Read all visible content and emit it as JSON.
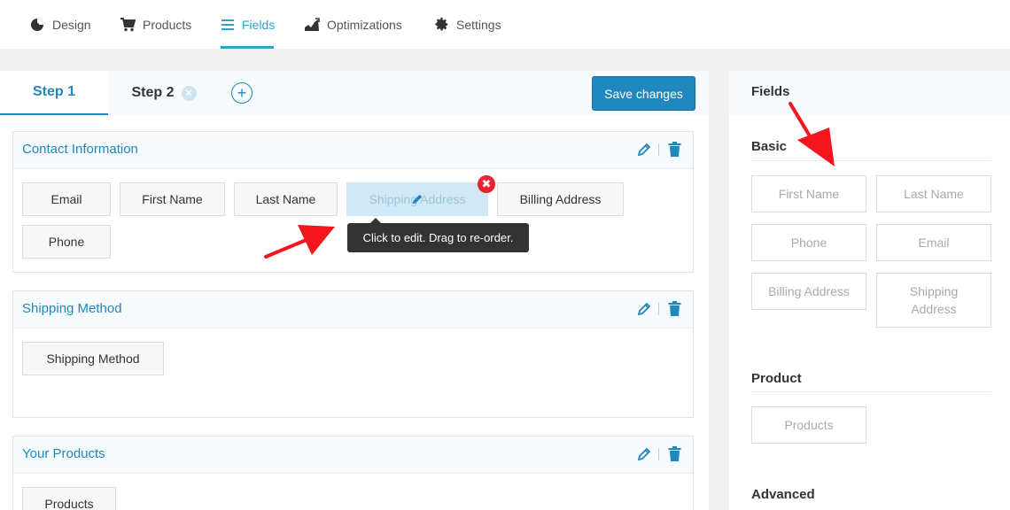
{
  "nav": {
    "items": [
      {
        "label": "Design",
        "icon": "design-icon"
      },
      {
        "label": "Products",
        "icon": "cart-icon"
      },
      {
        "label": "Fields",
        "icon": "list-icon"
      },
      {
        "label": "Optimizations",
        "icon": "chart-icon"
      },
      {
        "label": "Settings",
        "icon": "gear-icon"
      }
    ],
    "active": "Fields"
  },
  "steps": {
    "tabs": [
      {
        "label": "Step 1",
        "active": true
      },
      {
        "label": "Step 2",
        "active": false
      }
    ],
    "remove_glyph": "✕",
    "add_glyph": "+",
    "save_label": "Save changes"
  },
  "sections": [
    {
      "title": "Contact Information",
      "fields": [
        "Email",
        "First Name",
        "Last Name",
        "Shipping Address",
        "Billing Address",
        "Phone"
      ]
    },
    {
      "title": "Shipping Method",
      "fields": [
        "Shipping Method"
      ]
    },
    {
      "title": "Your Products",
      "fields": [
        "Products"
      ]
    }
  ],
  "tooltip": "Click to edit. Drag to re-order.",
  "remove_glyph": "✖",
  "palette": {
    "title": "Fields",
    "groups": [
      {
        "title": "Basic",
        "fields": [
          "First Name",
          "Last Name",
          "Phone",
          "Email",
          "Billing Address",
          "Shipping Address"
        ]
      },
      {
        "title": "Product",
        "fields": [
          "Products"
        ]
      },
      {
        "title": "Advanced",
        "fields": []
      }
    ]
  },
  "colors": {
    "accent": "#1f88be",
    "nav_active": "#2ea2cc",
    "remove": "#e8222f",
    "arrow": "#f5151d"
  }
}
